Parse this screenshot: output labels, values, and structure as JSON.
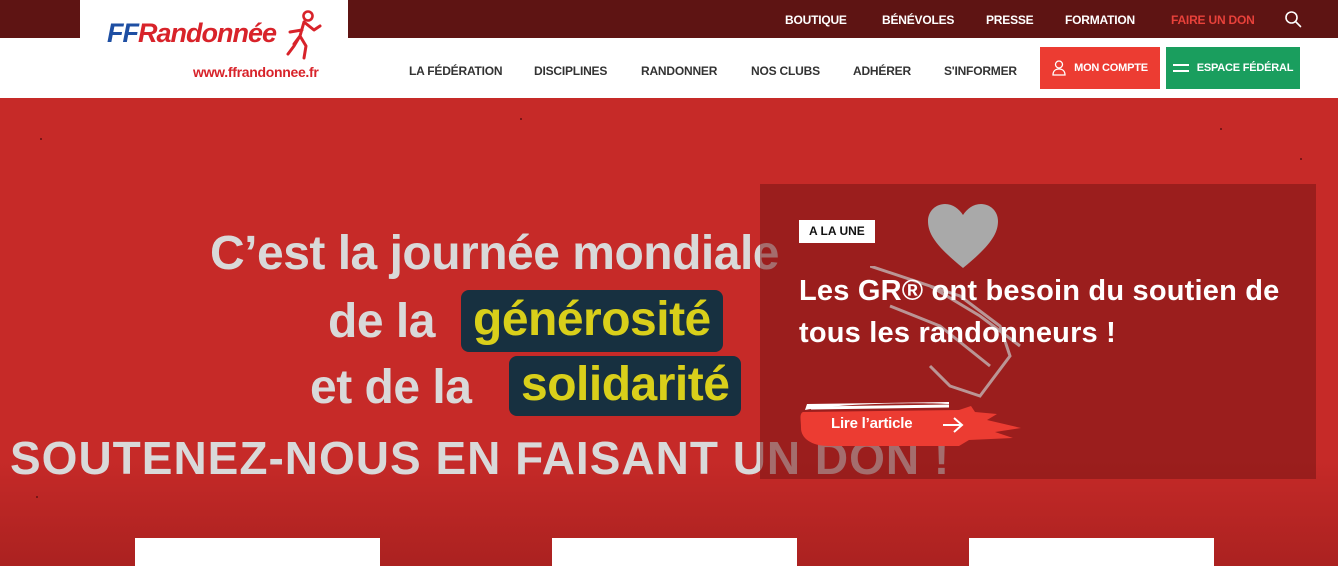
{
  "topbar": {
    "links": [
      "BOUTIQUE",
      "BÉNÉVOLES",
      "PRESSE",
      "FORMATION",
      "FAIRE UN DON"
    ],
    "search_icon": "search-icon"
  },
  "logo": {
    "brand_ff": "FF",
    "brand_rest": "Randonnée",
    "url": "www.ffrandonnee.fr"
  },
  "nav": {
    "items": [
      "LA FÉDÉRATION",
      "DISCIPLINES",
      "RANDONNER",
      "NOS CLUBS",
      "ADHÉRER",
      "S'INFORMER"
    ],
    "account_label": "MON COMPTE",
    "federal_label": "ESPACE FÉDÉRAL"
  },
  "hero": {
    "line1": "C’est la journée mondiale",
    "line2_prefix": "de la",
    "line2_highlight": "générosité",
    "line3_prefix": "et de la",
    "line3_highlight": "solidarité",
    "line4": "SOUTENEZ-NOUS EN FAISANT UN DON !"
  },
  "feature": {
    "badge": "A LA UNE",
    "title": "Les GR® ont besoin du soutien de tous les randonneurs !",
    "cta_label": "Lire l’article"
  },
  "colors": {
    "topbar_bg": "#5e1413",
    "hero_bg": "#c62a28",
    "account_btn": "#ec3c32",
    "federal_btn": "#1a9e5e",
    "donate_link": "#e8413a",
    "highlight_box": "#173040",
    "highlight_text": "#d9cf1a"
  }
}
